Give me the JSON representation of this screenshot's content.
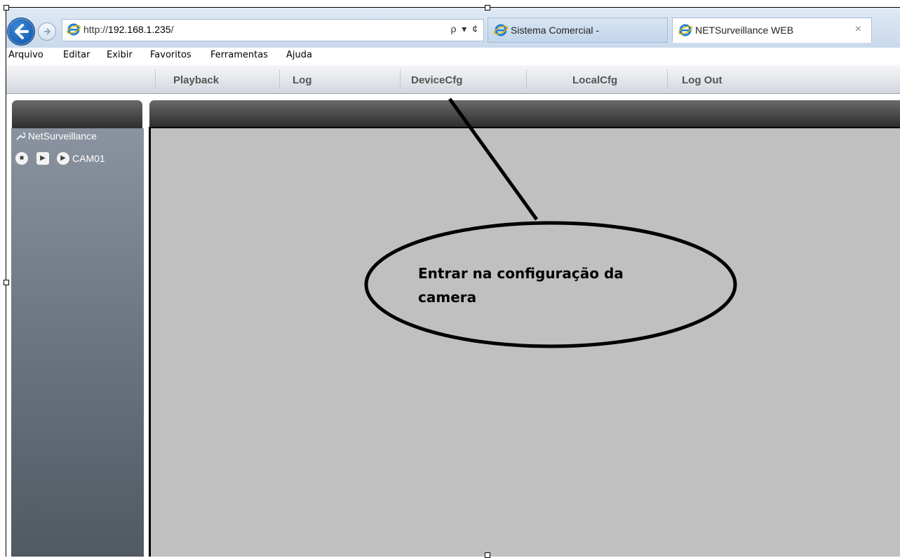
{
  "browser": {
    "url_prefix": "http://",
    "url_host": "192.168.1.235",
    "url_suffix": "/",
    "url_tools": "ρ ▾ ¢",
    "tabs": [
      {
        "label": "Sistema Comercial -",
        "active": false
      },
      {
        "label": "NETSurveillance WEB",
        "active": true,
        "close": "×"
      }
    ],
    "menu": [
      "Arquivo",
      "Editar",
      "Exibir",
      "Favoritos",
      "Ferramentas",
      "Ajuda"
    ]
  },
  "nav": {
    "items": [
      "Playback",
      "Log",
      "DeviceCfg",
      "LocalCfg",
      "Log Out"
    ]
  },
  "sidebar": {
    "root_label": "NetSurveillance",
    "camera_label": "CAM01",
    "camera_controls": [
      "stop-icon",
      "play-square-icon",
      "play-circle-icon"
    ]
  },
  "annotation": {
    "text_line1": "Entrar na configuração da",
    "text_line2": "camera"
  },
  "colors": {
    "accent_blue": "#1a5fb4",
    "viewport_gray": "#c0c0c0",
    "panel_header": "#3a3a3a"
  }
}
